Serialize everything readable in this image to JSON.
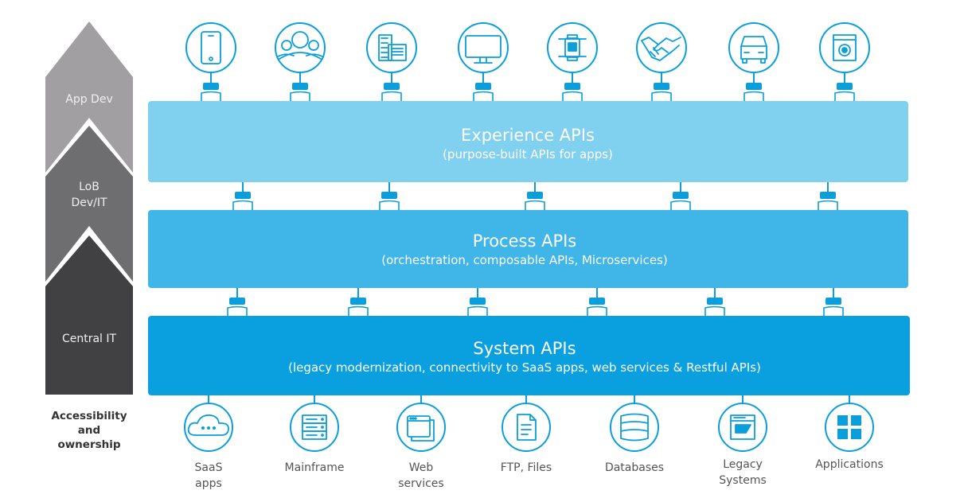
{
  "ownership": {
    "levels": [
      {
        "label_lines": [
          "App Dev"
        ],
        "color": "#a19fa2"
      },
      {
        "label_lines": [
          "LoB",
          "Dev/IT"
        ],
        "color": "#6e6d6f"
      },
      {
        "label_lines": [
          "Central IT"
        ],
        "color": "#414042"
      }
    ],
    "caption_lines": [
      "Accessibility",
      "and",
      "ownership"
    ]
  },
  "layers": {
    "experience": {
      "title": "Experience APIs",
      "subtitle": "(purpose-built APIs for apps)",
      "color": "#80d0f0"
    },
    "process": {
      "title": "Process APIs",
      "subtitle": "(orchestration, composable APIs, Microservices)",
      "color": "#3fb6e7"
    },
    "system": {
      "title": "System APIs",
      "subtitle": "(legacy modernization, connectivity to SaaS apps, web services & Restful APIs)",
      "color": "#0aa0df"
    }
  },
  "consumers": [
    {
      "icon": "tablet-icon"
    },
    {
      "icon": "people-group-icon"
    },
    {
      "icon": "office-building-icon"
    },
    {
      "icon": "monitor-icon"
    },
    {
      "icon": "smartwatch-icon"
    },
    {
      "icon": "handshake-icon"
    },
    {
      "icon": "car-icon"
    },
    {
      "icon": "washing-machine-icon"
    }
  ],
  "sources": [
    {
      "icon": "cloud-icon",
      "label_lines": [
        "SaaS",
        "apps"
      ]
    },
    {
      "icon": "server-rack-icon",
      "label_lines": [
        "Mainframe"
      ]
    },
    {
      "icon": "browser-windows-icon",
      "label_lines": [
        "Web",
        "services"
      ]
    },
    {
      "icon": "document-icon",
      "label_lines": [
        "FTP, Files"
      ]
    },
    {
      "icon": "database-icon",
      "label_lines": [
        "Databases"
      ]
    },
    {
      "icon": "sap-window-icon",
      "label_lines": [
        "Legacy",
        "Systems"
      ]
    },
    {
      "icon": "app-grid-icon",
      "label_lines": [
        "Applications"
      ]
    }
  ],
  "connector_color": "#0a9fdc"
}
